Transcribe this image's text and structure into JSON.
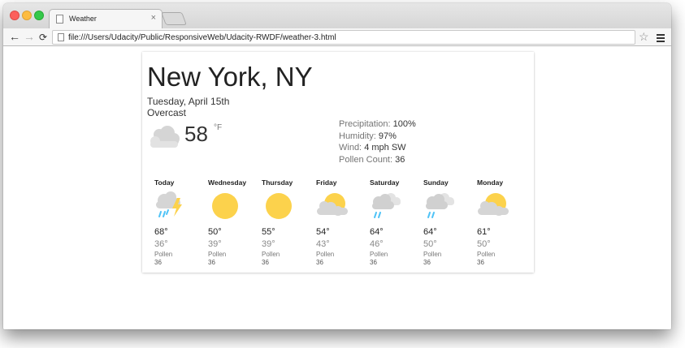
{
  "browser": {
    "tab_title": "Weather",
    "tab_close": "×",
    "url": "file:///Users/Udacity/Public/ResponsiveWeb/Udacity-RWDF/weather-3.html"
  },
  "weather": {
    "location": "New York, NY",
    "date": "Tuesday, April 15th",
    "description": "Overcast",
    "current": {
      "temp": "58",
      "unit": "°F",
      "icon": "cloudy-icon"
    },
    "stats": [
      {
        "label": "Precipitation:",
        "value": "100%"
      },
      {
        "label": "Humidity:",
        "value": "97%"
      },
      {
        "label": "Wind:",
        "value": "4 mph SW"
      },
      {
        "label": "Pollen Count:",
        "value": "36"
      }
    ],
    "days": [
      {
        "name": "Today",
        "icon": "thunderstorm-icon",
        "hi": "68°",
        "lo": "36°",
        "pollen_label": "Pollen",
        "pollen": "36"
      },
      {
        "name": "Wednesday",
        "icon": "sunny-icon",
        "hi": "50°",
        "lo": "39°",
        "pollen_label": "Pollen",
        "pollen": "36"
      },
      {
        "name": "Thursday",
        "icon": "sunny-icon",
        "hi": "55°",
        "lo": "39°",
        "pollen_label": "Pollen",
        "pollen": "36"
      },
      {
        "name": "Friday",
        "icon": "partly-cloudy-icon",
        "hi": "54°",
        "lo": "43°",
        "pollen_label": "Pollen",
        "pollen": "36"
      },
      {
        "name": "Saturday",
        "icon": "rain-icon",
        "hi": "64°",
        "lo": "46°",
        "pollen_label": "Pollen",
        "pollen": "36"
      },
      {
        "name": "Sunday",
        "icon": "rain-icon",
        "hi": "64°",
        "lo": "50°",
        "pollen_label": "Pollen",
        "pollen": "36"
      },
      {
        "name": "Monday",
        "icon": "partly-cloudy-icon",
        "hi": "61°",
        "lo": "50°",
        "pollen_label": "Pollen",
        "pollen": "36"
      }
    ]
  },
  "colors": {
    "sun": "#fcd24c",
    "cloud": "#d5d5d5",
    "rain": "#4fc3f7",
    "lightning": "#fcd24c"
  }
}
